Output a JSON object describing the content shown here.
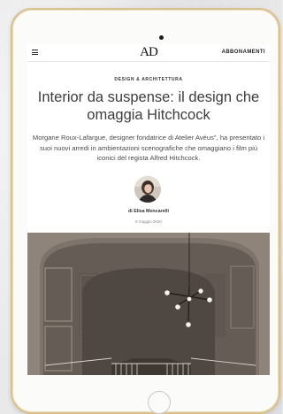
{
  "header": {
    "menu_icon": "hamburger-menu-icon",
    "logo_text": "AD",
    "subscribe_label": "ABBONAMENTI"
  },
  "article": {
    "category": "DESIGN & ARCHITETTURA",
    "title": "Interior da suspense: il design che omaggia Hitchcock",
    "dek": "Morgane Roux-Lafargue, designer fondatrice di Atelier Avéus\", ha presentato i suoi nuovi arredi in ambientazioni scenografiche che omaggiano i film più iconici del regista Alfred Hitchcock.",
    "author": "di Elisa Mencarelli",
    "date": "8 maggio 2020"
  },
  "colors": {
    "tablet_frame": "#fbfbfa",
    "tablet_bezel_gold": "#d9c08f",
    "headline": "#3d3d3d",
    "hero_wall": "#8a7f75"
  }
}
